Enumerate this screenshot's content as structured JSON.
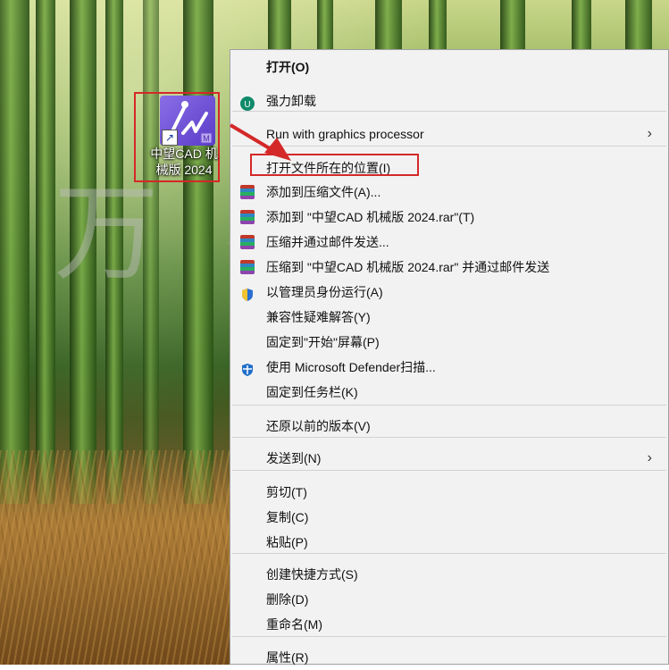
{
  "desktop": {
    "watermark": "万 卷 云 共 享",
    "icon": {
      "label": "中望CAD 机械版 2024",
      "icon": "zwcad-mechanical-icon",
      "badge": "M"
    }
  },
  "menu": {
    "items": [
      {
        "label": "打开(O)",
        "bold": true
      },
      {
        "label": "强力卸载",
        "icon": "uninstall-icon"
      },
      {
        "label": "Run with graphics processor",
        "submenu": true
      },
      {
        "label": "打开文件所在的位置(I)"
      },
      {
        "label": "添加到压缩文件(A)...",
        "icon": "winrar-icon"
      },
      {
        "label": "添加到 \"中望CAD 机械版 2024.rar\"(T)",
        "icon": "winrar-icon"
      },
      {
        "label": "压缩并通过邮件发送...",
        "icon": "winrar-icon"
      },
      {
        "label": "压缩到 \"中望CAD 机械版 2024.rar\" 并通过邮件发送",
        "icon": "winrar-icon"
      },
      {
        "label": "以管理员身份运行(A)",
        "icon": "shield-icon"
      },
      {
        "label": "兼容性疑难解答(Y)"
      },
      {
        "label": "固定到\"开始\"屏幕(P)"
      },
      {
        "label": "使用 Microsoft Defender扫描...",
        "icon": "defender-icon"
      },
      {
        "label": "固定到任务栏(K)"
      },
      {
        "label": "还原以前的版本(V)"
      },
      {
        "label": "发送到(N)",
        "submenu": true
      },
      {
        "label": "剪切(T)"
      },
      {
        "label": "复制(C)"
      },
      {
        "label": "粘贴(P)"
      },
      {
        "label": "创建快捷方式(S)"
      },
      {
        "label": "删除(D)"
      },
      {
        "label": "重命名(M)"
      },
      {
        "label": "属性(R)"
      }
    ],
    "submenu_glyph": "›"
  },
  "colors": {
    "highlight": "#d42828",
    "menu_bg": "#f2f2f2"
  }
}
